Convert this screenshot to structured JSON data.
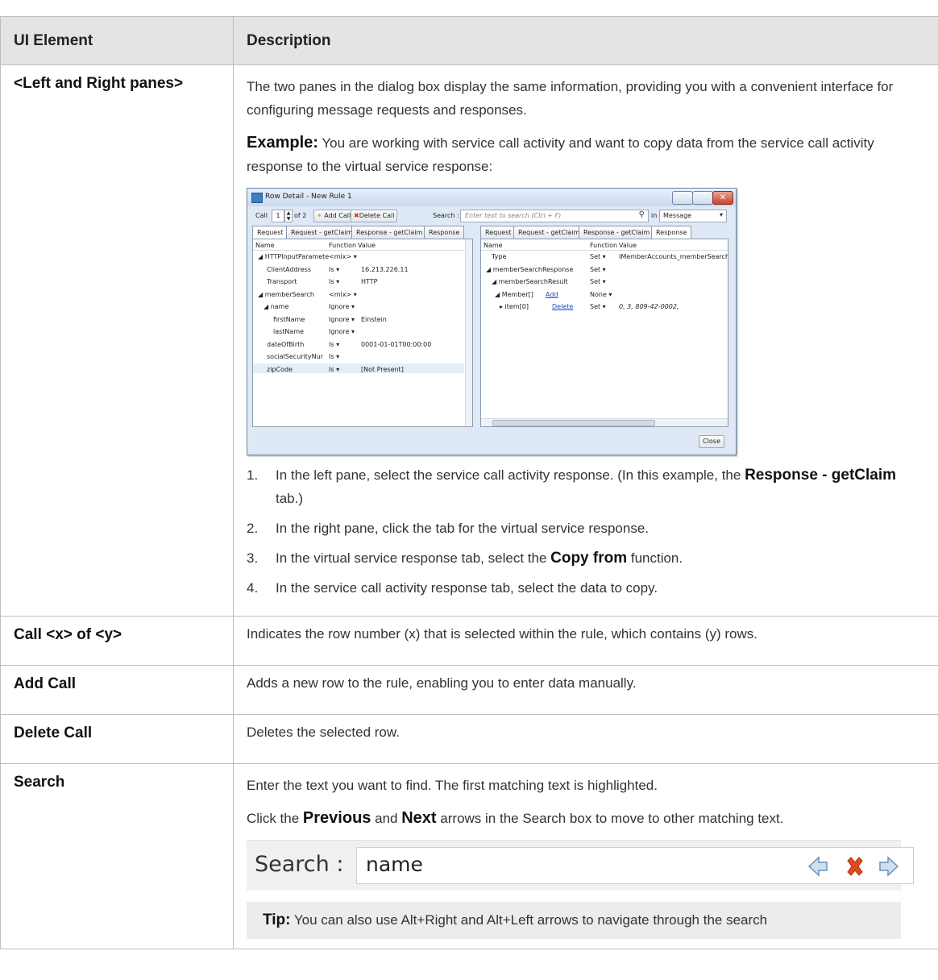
{
  "table": {
    "headers": {
      "element": "UI Element",
      "description": "Description"
    },
    "row1": {
      "element": "<Left and Right panes>",
      "p1": "The two panes in the dialog box display the same information, providing you with a convenient interface for configuring message requests and responses.",
      "p2_bold": "Example:",
      "p2": " You are working with service call activity and want to copy data from the service call activity response to the virtual service response:",
      "dialog": {
        "title": "Row Detail - New Rule 1",
        "call_label": "Call",
        "call_value": "1",
        "of_label": "of 2",
        "add_call": "Add Call",
        "delete_call": "Delete Call",
        "search_label": "Search :",
        "search_placeholder": "Enter text to search (Ctrl + F)",
        "in_label": "in",
        "scope_value": "Message",
        "left_tabs": [
          "Request",
          "Request - getClaim",
          "Response - getClaim",
          "Response"
        ],
        "right_tabs": [
          "Request",
          "Request - getClaim",
          "Response - getClaim",
          "Response"
        ],
        "col_name": "Name",
        "col_function": "Function",
        "col_value": "Value",
        "left_rows": [
          {
            "name": "◢ HTTPInputParamete",
            "function": "<mix> ▾",
            "value": ""
          },
          {
            "name": "ClientAddress",
            "function": "Is ▾",
            "value": "16.213.226.11"
          },
          {
            "name": "Transport",
            "function": "Is ▾",
            "value": "HTTP"
          },
          {
            "name": "◢ memberSearch",
            "function": "<mix> ▾",
            "value": ""
          },
          {
            "name": "◢ name",
            "function": "Ignore ▾",
            "value": ""
          },
          {
            "name": "firstName",
            "function": "Ignore ▾",
            "value": "Einstein"
          },
          {
            "name": "lastName",
            "function": "Ignore ▾",
            "value": ""
          },
          {
            "name": "dateOfBirth",
            "function": "Is ▾",
            "value": "0001-01-01T00:00:00"
          },
          {
            "name": "socialSecurityNur",
            "function": "Is ▾",
            "value": ""
          },
          {
            "name": "zipCode",
            "function": "Is ▾",
            "value": "[Not Present]"
          }
        ],
        "right_rows": [
          {
            "name": "Type",
            "function": "Set ▾",
            "value": "IMemberAccounts_memberSearch_O"
          },
          {
            "name": "◢ memberSearchResponse",
            "function": "Set ▾",
            "value": ""
          },
          {
            "name": "◢ memberSearchResult",
            "function": "Set ▾",
            "value": ""
          },
          {
            "name": "◢ Member[]",
            "link": "Add",
            "function": "None ▾",
            "value": ""
          },
          {
            "name": "▸ item[0]",
            "link": "Delete",
            "function": "Set ▾",
            "value": "0, 3, 809-42-0002,"
          }
        ],
        "close": "Close"
      },
      "steps": [
        {
          "num": "1.",
          "pre": "In the left pane, select the service call activity response. (In this example, the ",
          "bold": "Response - getClaim",
          "post": " tab.)"
        },
        {
          "num": "2.",
          "pre": "In the right pane, click the tab for the virtual service response.",
          "bold": "",
          "post": ""
        },
        {
          "num": "3.",
          "pre": "In the virtual service response tab, select the ",
          "bold": "Copy from",
          "post": " function."
        },
        {
          "num": "4.",
          "pre": "In the service call activity response tab, select the data to copy.",
          "bold": "",
          "post": ""
        }
      ]
    },
    "row2": {
      "element": "Call <x> of <y>",
      "description": "Indicates the row number (x) that is selected within the rule, which contains (y) rows."
    },
    "row3": {
      "element": "Add Call",
      "description": "Adds a new row to the rule, enabling you to enter data manually."
    },
    "row4": {
      "element": "Delete Call",
      "description": "Deletes the selected row."
    },
    "row5": {
      "element": "Search",
      "p1": "Enter the text you want to find. The first matching text is highlighted.",
      "p2_pre": "Click the ",
      "p2_b1": "Previous",
      "p2_mid": " and ",
      "p2_b2": "Next",
      "p2_post": " arrows in the Search box to move to other matching text.",
      "search_shot": {
        "label": "Search :",
        "value": "name"
      },
      "tip_bold": "Tip:",
      "tip": " You can also use Alt+Right and Alt+Left arrows to navigate through the search"
    }
  }
}
